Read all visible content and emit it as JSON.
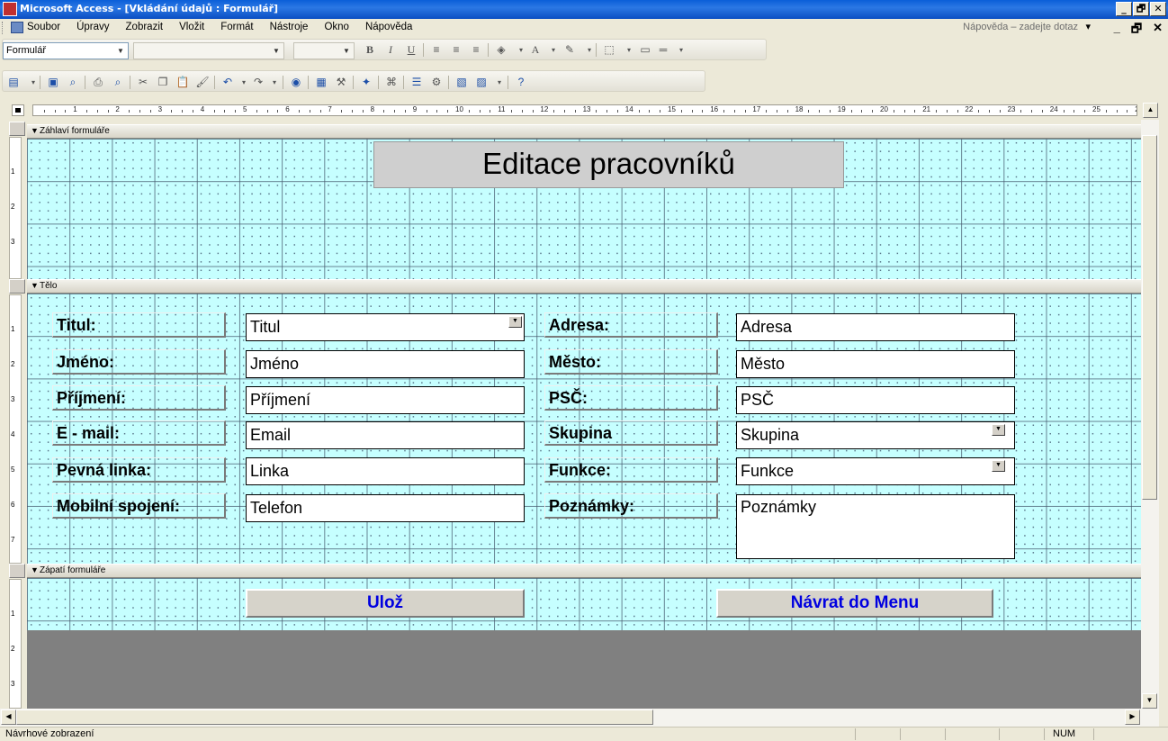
{
  "window": {
    "title": "Microsoft Access - [Vkládání údajů : Formulář]",
    "buttons": {
      "minimize": "_",
      "restore": "🗗",
      "close": "✕"
    }
  },
  "menubar": {
    "items": [
      "Soubor",
      "Úpravy",
      "Zobrazit",
      "Vložit",
      "Formát",
      "Nástroje",
      "Okno",
      "Nápověda"
    ],
    "help_placeholder": "Nápověda – zadejte dotaz",
    "mdi_buttons": [
      "_",
      "🗗",
      "✕"
    ]
  },
  "format_toolbar": {
    "object_combo": "Formulář",
    "bold": "B",
    "italic": "I",
    "underline": "U"
  },
  "ruler": {
    "numbers": [
      "1",
      "2",
      "3",
      "4",
      "5",
      "6",
      "7",
      "8",
      "9",
      "10",
      "11",
      "12",
      "13",
      "14",
      "15",
      "16",
      "17",
      "18",
      "19",
      "20",
      "21",
      "22",
      "23",
      "24",
      "25",
      "2"
    ]
  },
  "vruler": {
    "header_numbers": [
      "1",
      "2",
      "3"
    ],
    "detail_numbers": [
      "1",
      "2",
      "3",
      "4",
      "5",
      "6",
      "7"
    ],
    "footer_numbers": [
      "1",
      "2",
      "3"
    ]
  },
  "sections": {
    "header": "Záhlaví formuláře",
    "detail": "Tělo",
    "footer": "Zápatí formuláře"
  },
  "form": {
    "title": "Editace pracovníků",
    "left_labels": [
      "Titul:",
      "Jméno:",
      "Příjmení:",
      "E - mail:",
      "Pevná linka:",
      "Mobilní spojení:"
    ],
    "left_fields": [
      "Titul",
      "Jméno",
      "Příjmení",
      "Email",
      "Linka",
      "Telefon"
    ],
    "right_labels": [
      "Adresa:",
      "Město:",
      "PSČ:",
      "Skupina",
      "Funkce:",
      "Poznámky:"
    ],
    "right_fields": [
      "Adresa",
      "Město",
      "PSČ",
      "Skupina",
      "Funkce",
      "Poznámky"
    ],
    "save_button": "Ulož",
    "back_button": "Návrat do Menu"
  },
  "statusbar": {
    "status": "Návrhové zobrazení",
    "num": "NUM"
  },
  "colors": {
    "grid_background": "#c6ffff",
    "button_text": "#0000e0",
    "title_bar": "#0a5fd8"
  }
}
